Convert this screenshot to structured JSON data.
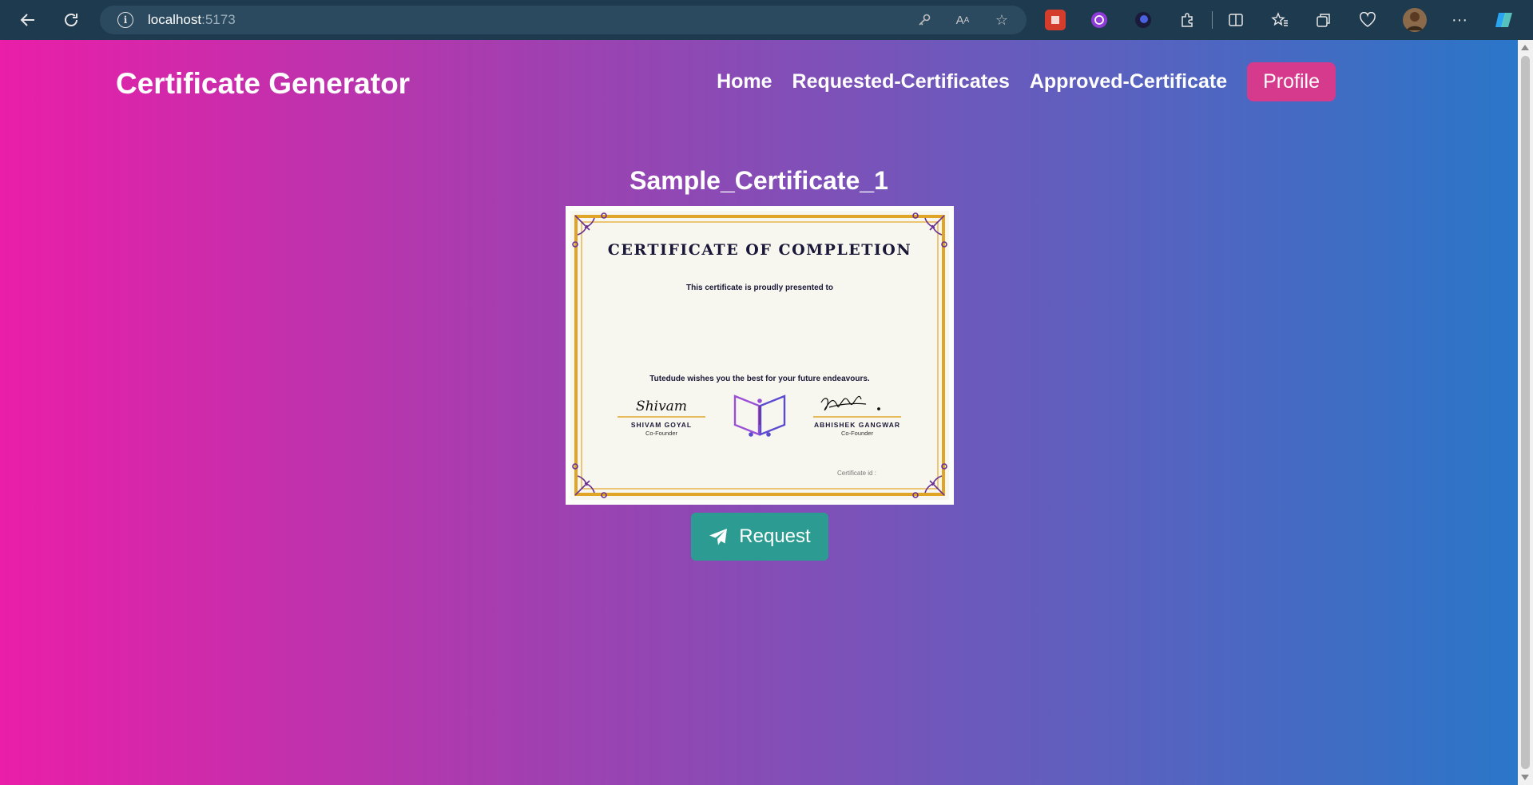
{
  "browser": {
    "url_host": "localhost",
    "url_port": ":5173"
  },
  "app": {
    "brand": "Certificate Generator",
    "nav": {
      "home": "Home",
      "requested": "Requested-Certificates",
      "approved": "Approved-Certificate",
      "profile": "Profile"
    }
  },
  "certificate": {
    "name": "Sample_Certificate_1",
    "heading": "CERTIFICATE OF COMPLETION",
    "presented_to": "This certificate is proudly presented to",
    "wishes": "Tutedude wishes you the best for your future endeavours.",
    "signer_left": {
      "signature": "Shivam",
      "name": "SHIVAM GOYAL",
      "role": "Co-Founder"
    },
    "signer_right": {
      "name": "ABHISHEK GANGWAR",
      "role": "Co-Founder"
    },
    "certificate_id_label": "Certificate id :"
  },
  "actions": {
    "request_label": "Request"
  },
  "colors": {
    "gradient_start": "#ea1ea8",
    "gradient_end": "#2a76c8",
    "profile_button": "#d63a8c",
    "request_button": "#2c9c92",
    "certificate_border": "#e0a526"
  }
}
